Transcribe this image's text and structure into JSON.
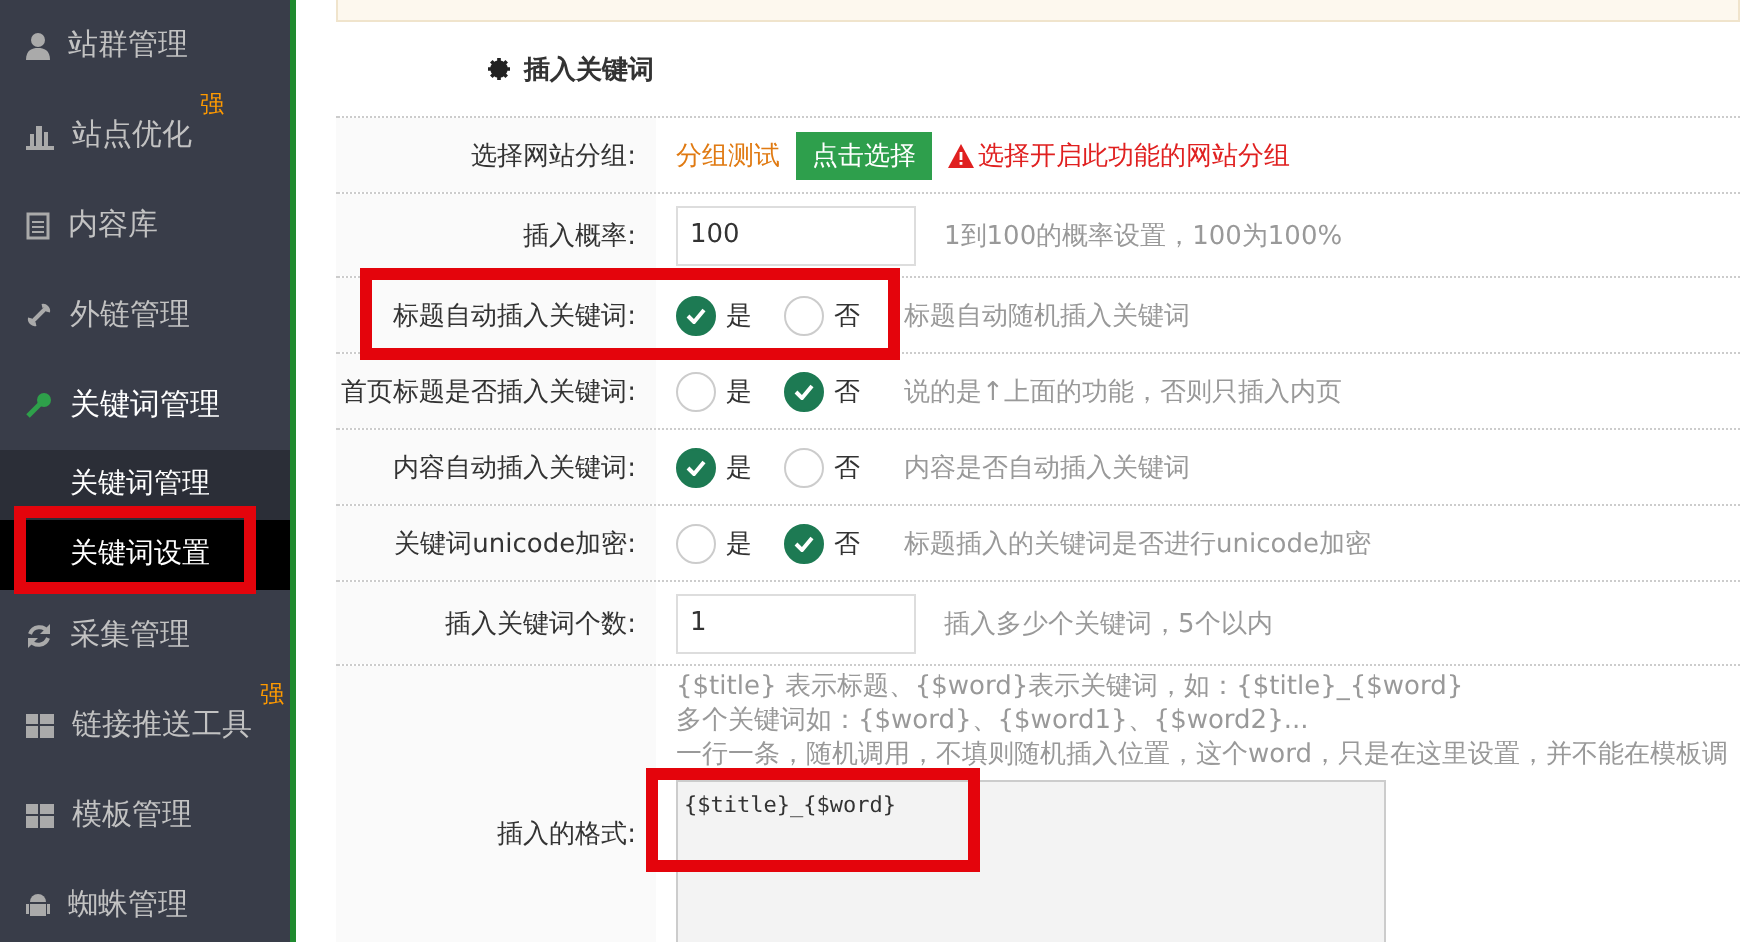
{
  "sidebar": {
    "items": [
      {
        "label": "站群管理",
        "expanded": false
      },
      {
        "label": "站点优化",
        "badge": "强",
        "expanded": false
      },
      {
        "label": "内容库",
        "expanded": false
      },
      {
        "label": "外链管理",
        "expanded": false
      },
      {
        "label": "关键词管理",
        "expanded": true,
        "children": [
          {
            "label": "关键词管理",
            "selected": false
          },
          {
            "label": "关键词设置",
            "selected": true
          }
        ]
      },
      {
        "label": "采集管理",
        "expanded": false
      },
      {
        "label": "链接推送工具",
        "badge": "强",
        "expanded": false
      },
      {
        "label": "模板管理",
        "expanded": false
      },
      {
        "label": "蜘蛛管理",
        "expanded": false
      }
    ]
  },
  "form": {
    "title": "插入关键词",
    "rows": [
      {
        "kind": "group",
        "label": "选择网站分组:",
        "value": "分组测试",
        "button": "点击选择",
        "warning": "选择开启此功能的网站分组"
      },
      {
        "kind": "input",
        "label": "插入概率:",
        "value": "100",
        "help": "1到100的概率设置，100为100%"
      },
      {
        "kind": "radio",
        "label": "标题自动插入关键词:",
        "options": [
          {
            "label": "是",
            "selected": true
          },
          {
            "label": "否",
            "selected": false
          }
        ],
        "help": "标题自动随机插入关键词"
      },
      {
        "kind": "radio",
        "label": "首页标题是否插入关键词:",
        "options": [
          {
            "label": "是",
            "selected": false
          },
          {
            "label": "否",
            "selected": true
          }
        ],
        "help": "说的是↑上面的功能，否则只插入内页"
      },
      {
        "kind": "radio",
        "label": "内容自动插入关键词:",
        "options": [
          {
            "label": "是",
            "selected": true
          },
          {
            "label": "否",
            "selected": false
          }
        ],
        "help": "内容是否自动插入关键词"
      },
      {
        "kind": "radio",
        "label": "关键词unicode加密:",
        "options": [
          {
            "label": "是",
            "selected": false
          },
          {
            "label": "否",
            "selected": true
          }
        ],
        "help": "标题插入的关键词是否进行unicode加密"
      },
      {
        "kind": "input",
        "label": "插入关键词个数:",
        "value": "1",
        "help": "插入多少个关键词，5个以内"
      },
      {
        "kind": "textarea",
        "label": "插入的格式:",
        "help_lines": [
          "{$title} 表示标题、{$word}表示关键词，如：{$title}_{$word}",
          "多个关键词如：{$word}、{$word1}、{$word2}...",
          "一行一条，随机调用，不填则随机插入位置，这个word，只是在这里设置，并不能在模板调"
        ],
        "value": "{$title}_{$word}"
      }
    ]
  }
}
